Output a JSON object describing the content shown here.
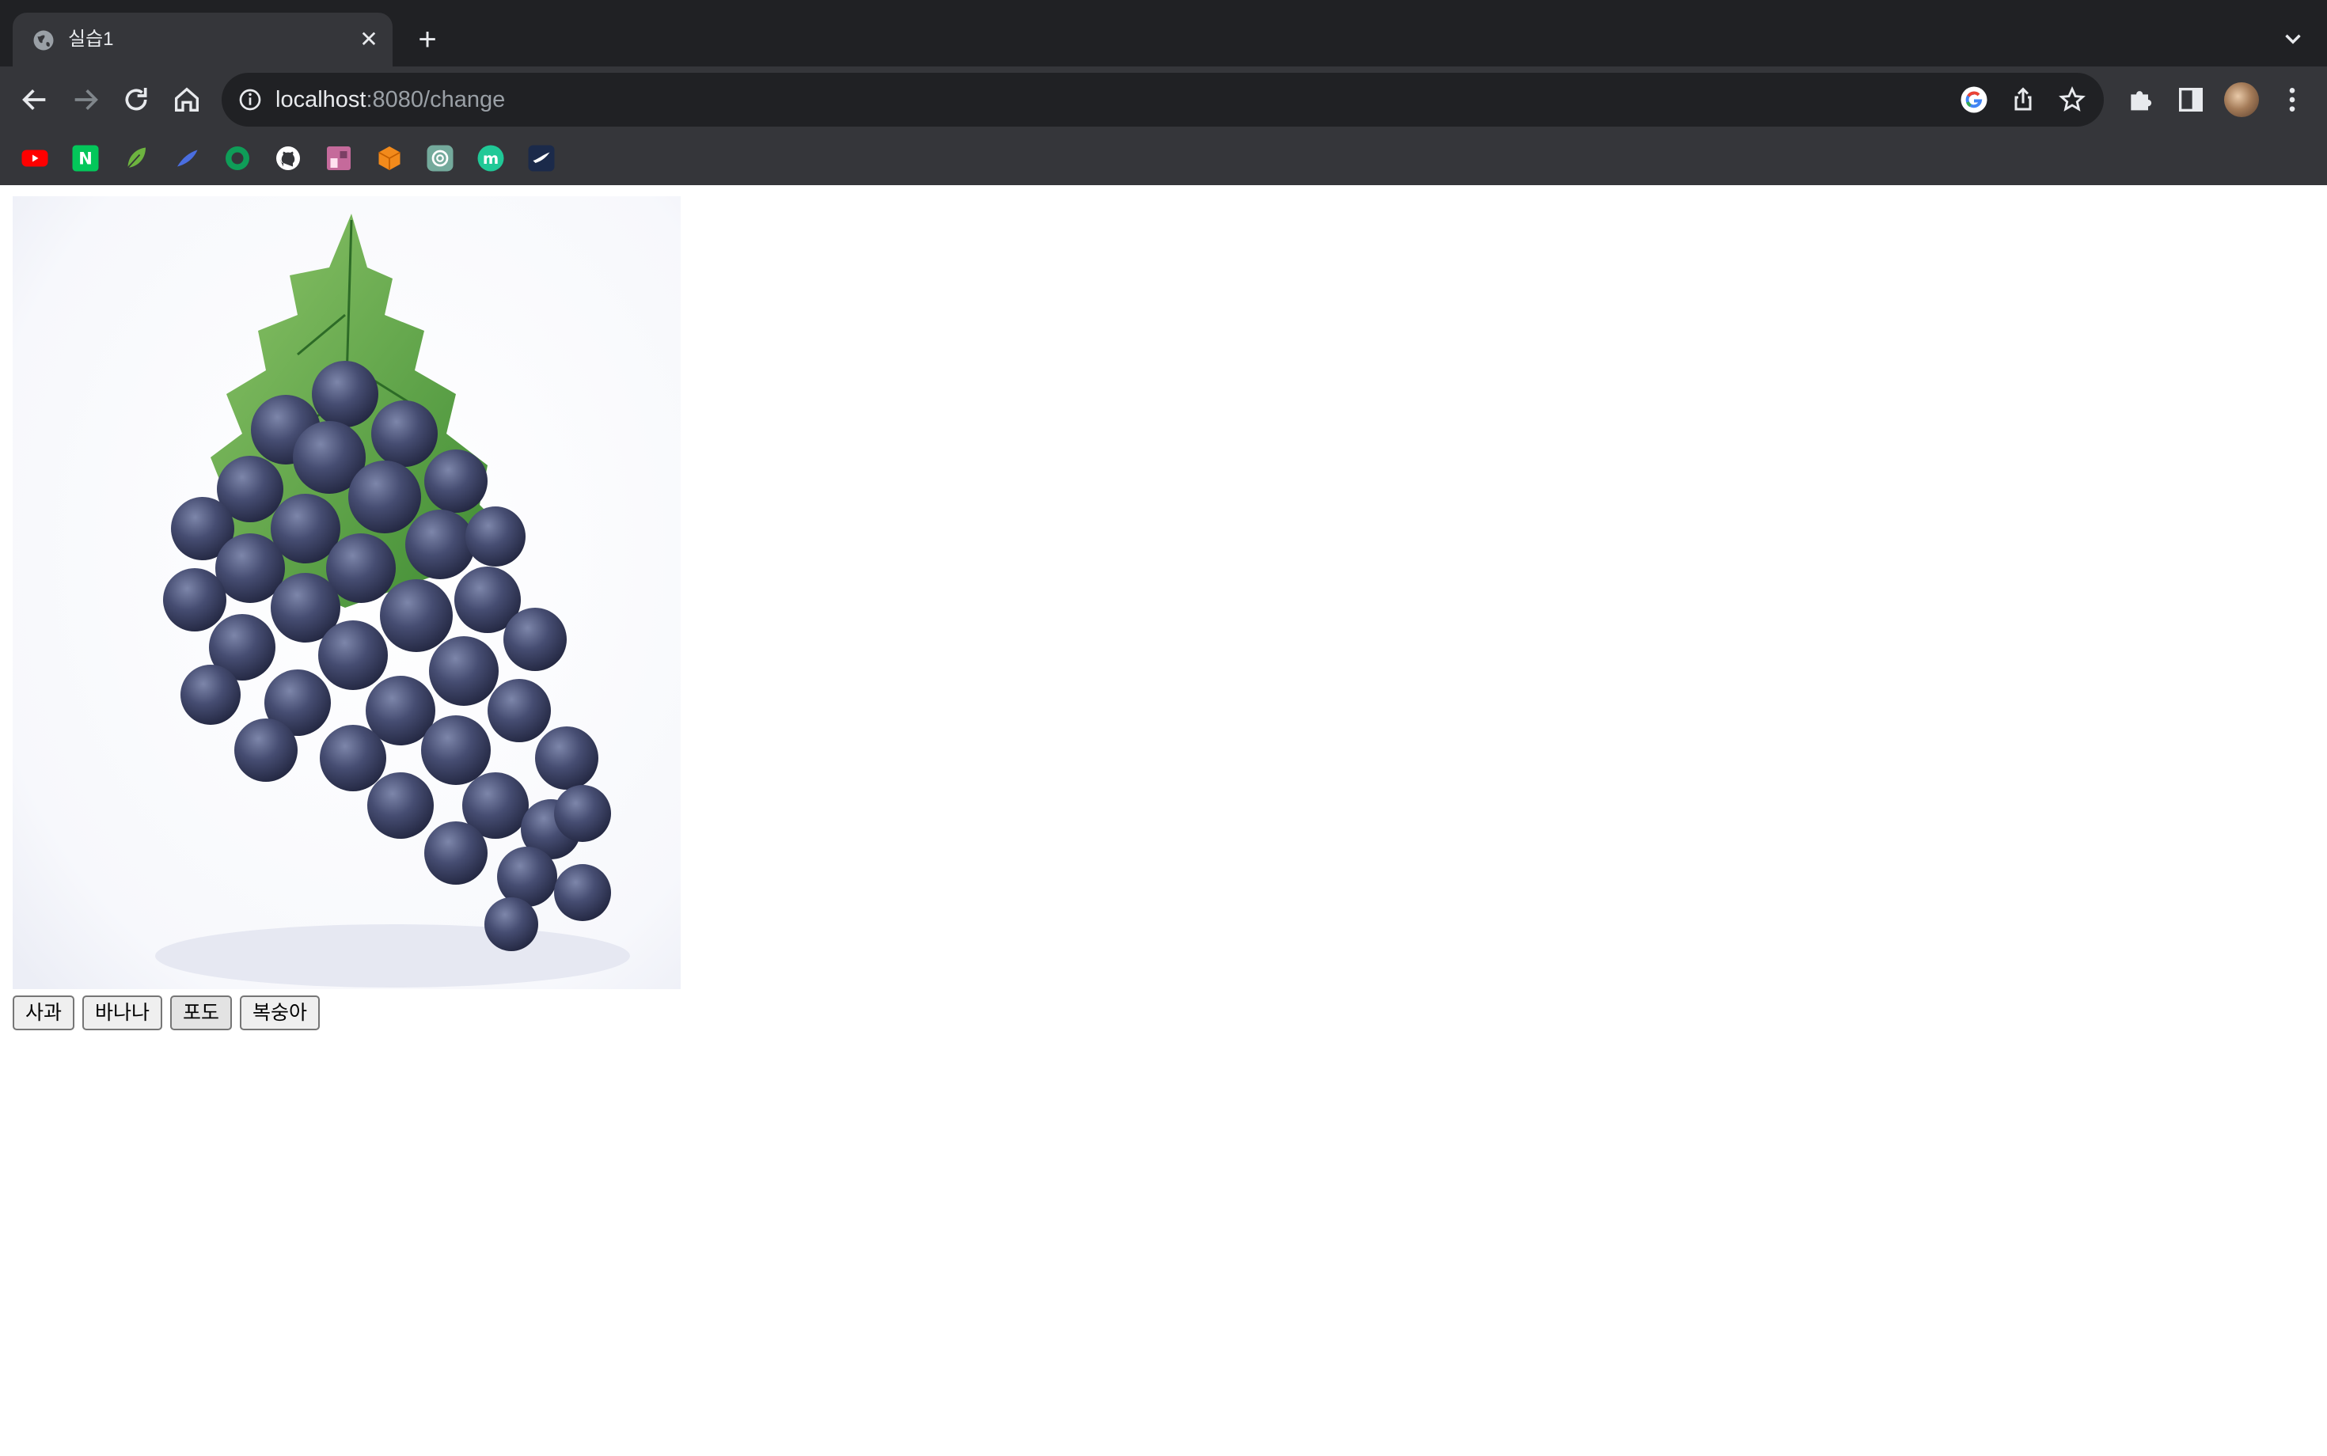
{
  "browser": {
    "tab": {
      "title": "실습1",
      "close_glyph": "✕"
    },
    "new_tab_glyph": "+",
    "omnibox": {
      "host": "localhost",
      "path": ":8080/change"
    },
    "bookmarks": [
      {
        "name": "youtube-icon",
        "color": "#ff0000"
      },
      {
        "name": "naver-icon",
        "color": "#03c75a",
        "glyph": "N"
      },
      {
        "name": "leaf-icon",
        "color": "#6db33f"
      },
      {
        "name": "feather-icon",
        "color": "#4a6ee0"
      },
      {
        "name": "green-circle-icon",
        "color": "#0f9d58"
      },
      {
        "name": "github-icon",
        "color": "#ffffff"
      },
      {
        "name": "photo-icon",
        "color": "#c56a9b"
      },
      {
        "name": "cube-icon",
        "color": "#f28a1b"
      },
      {
        "name": "chatgpt-icon",
        "color": "#74aa9c"
      },
      {
        "name": "m-circle-icon",
        "color": "#20c997",
        "glyph": "m"
      },
      {
        "name": "bird-icon",
        "color": "#1b2a4a"
      }
    ]
  },
  "page": {
    "image_alt": "포도",
    "buttons": [
      "사과",
      "바나나",
      "포도",
      "복숭아"
    ],
    "selected": "포도"
  }
}
